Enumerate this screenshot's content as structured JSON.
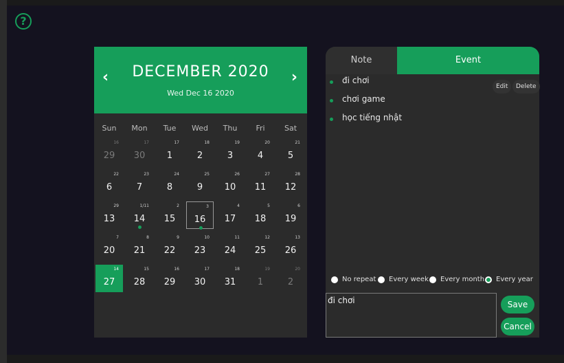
{
  "app": {
    "help_icon": "question-circle-icon",
    "help_glyph": "?",
    "accent": "#169e5a"
  },
  "calendar": {
    "prev_glyph": "‹",
    "next_glyph": "›",
    "month_title": "DECEMBER 2020",
    "selected_date": "Wed Dec 16 2020",
    "weekdays": [
      "Sun",
      "Mon",
      "Tue",
      "Wed",
      "Thu",
      "Fri",
      "Sat"
    ],
    "weeks": [
      [
        {
          "d": "29",
          "l": "16",
          "out": true
        },
        {
          "d": "30",
          "l": "17",
          "out": true
        },
        {
          "d": "1",
          "l": "17"
        },
        {
          "d": "2",
          "l": "18"
        },
        {
          "d": "3",
          "l": "19"
        },
        {
          "d": "4",
          "l": "20"
        },
        {
          "d": "5",
          "l": "21"
        }
      ],
      [
        {
          "d": "6",
          "l": "22"
        },
        {
          "d": "7",
          "l": "23"
        },
        {
          "d": "8",
          "l": "24"
        },
        {
          "d": "9",
          "l": "25"
        },
        {
          "d": "10",
          "l": "26"
        },
        {
          "d": "11",
          "l": "27"
        },
        {
          "d": "12",
          "l": "28"
        }
      ],
      [
        {
          "d": "13",
          "l": "29"
        },
        {
          "d": "14",
          "l": "1/11",
          "dot": true
        },
        {
          "d": "15",
          "l": "2"
        },
        {
          "d": "16",
          "l": "3",
          "dot": true,
          "selected": true
        },
        {
          "d": "17",
          "l": "4"
        },
        {
          "d": "18",
          "l": "5"
        },
        {
          "d": "19",
          "l": "6"
        }
      ],
      [
        {
          "d": "20",
          "l": "7"
        },
        {
          "d": "21",
          "l": "8"
        },
        {
          "d": "22",
          "l": "9"
        },
        {
          "d": "23",
          "l": "10"
        },
        {
          "d": "24",
          "l": "11"
        },
        {
          "d": "25",
          "l": "12"
        },
        {
          "d": "26",
          "l": "13"
        }
      ],
      [
        {
          "d": "27",
          "l": "14",
          "today": true
        },
        {
          "d": "28",
          "l": "15"
        },
        {
          "d": "29",
          "l": "16"
        },
        {
          "d": "30",
          "l": "17"
        },
        {
          "d": "31",
          "l": "18"
        },
        {
          "d": "1",
          "l": "19",
          "out": true
        },
        {
          "d": "2",
          "l": "20",
          "out": true
        }
      ]
    ]
  },
  "panel": {
    "tabs": {
      "note": "Note",
      "event": "Event"
    },
    "events": [
      "đi chơi",
      "chơi game",
      "học tiếng nhật"
    ],
    "edit_label": "Edit",
    "delete_label": "Delete",
    "repeat_options": [
      {
        "label": "No repeat",
        "checked": false
      },
      {
        "label": "Every week",
        "checked": false
      },
      {
        "label": "Every month",
        "checked": false
      },
      {
        "label": "Every year",
        "checked": true
      }
    ],
    "input_value": "đi chơi",
    "save_label": "Save",
    "cancel_label": "Cancel"
  }
}
